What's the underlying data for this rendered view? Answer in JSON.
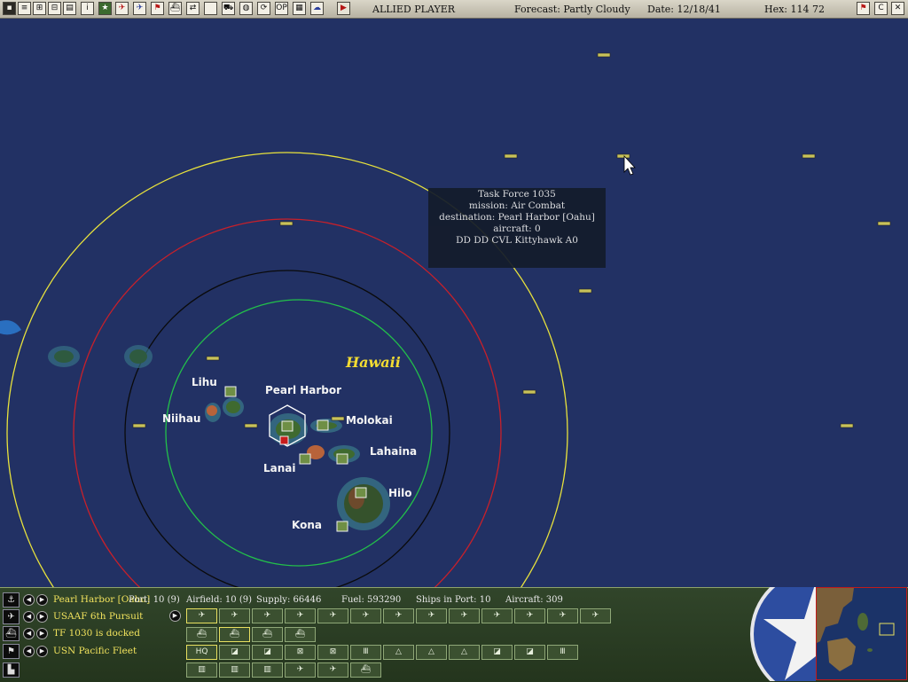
{
  "topbar": {
    "player": "ALLIED PLAYER",
    "forecast": "Forecast: Partly Cloudy",
    "date": "Date: 12/18/41",
    "hex": "Hex: 114  72",
    "op_label": "OP",
    "c_label": "C"
  },
  "map": {
    "region_label": "Hawaii",
    "labels": {
      "lihu": "Lihu",
      "niihau": "Niihau",
      "pearl": "Pearl Harbor",
      "molokai": "Molokai",
      "lanai": "Lanai",
      "lahaina": "Lahaina",
      "hilo": "Hilo",
      "kona": "Kona"
    },
    "ring_colors": [
      "#e8e23c",
      "#c8202a",
      "#0a0a0a",
      "#22c04a"
    ]
  },
  "tooltip": {
    "line1": "Task Force 1035",
    "line2": "mission: Air Combat",
    "line3": "destination: Pearl Harbor [Oahu]",
    "line4": "aircraft: 0",
    "line5": "DD DD CVL Kittyhawk A0"
  },
  "panel": {
    "base_name": "Pearl Harbor [Oahu]",
    "air_group": "USAAF 6th Pursuit",
    "task_force": "TF 1030 is docked",
    "fleet": "USN Pacific Fleet",
    "stats": {
      "port": "Port: 10 (9)",
      "airfield": "Airfield: 10 (9)",
      "supply": "Supply: 66446",
      "fuel": "Fuel: 593290",
      "ships": "Ships in Port: 10",
      "aircraft": "Aircraft: 309"
    },
    "hq_label": "HQ"
  }
}
